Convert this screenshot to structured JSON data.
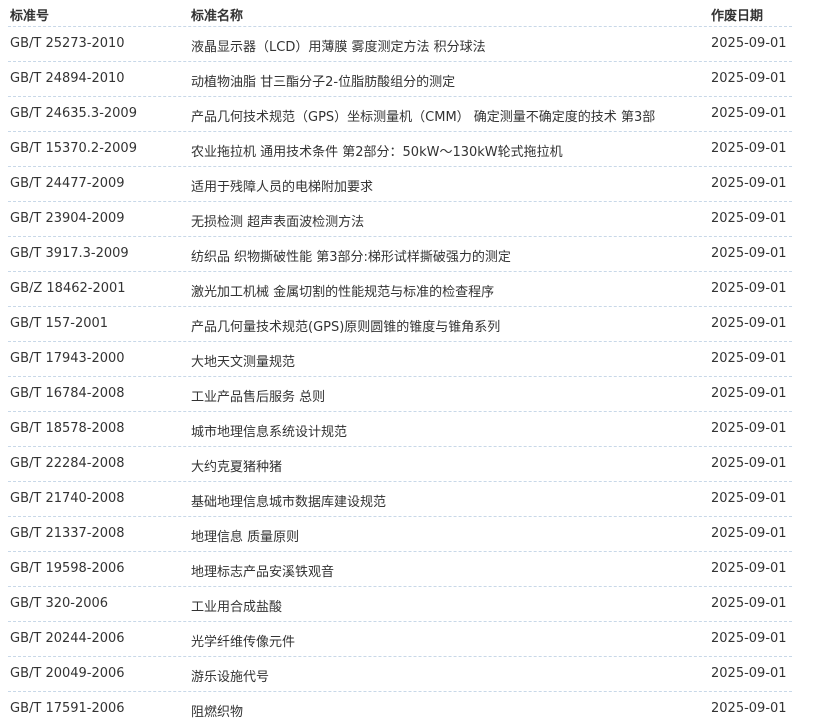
{
  "table": {
    "headers": {
      "code": "标准号",
      "name": "标准名称",
      "date": "作废日期"
    },
    "rows": [
      {
        "code": "GB/T 25273-2010",
        "name": "液晶显示器（LCD）用薄膜 雾度测定方法 积分球法",
        "date": "2025-09-01"
      },
      {
        "code": "GB/T 24894-2010",
        "name": "动植物油脂 甘三酯分子2-位脂肪酸组分的测定",
        "date": "2025-09-01"
      },
      {
        "code": "GB/T 24635.3-2009",
        "name": "产品几何技术规范（GPS）坐标测量机（CMM） 确定测量不确定度的技术 第3部",
        "date": "2025-09-01"
      },
      {
        "code": "GB/T 15370.2-2009",
        "name": "农业拖拉机 通用技术条件 第2部分：50kW～130kW轮式拖拉机",
        "date": "2025-09-01"
      },
      {
        "code": "GB/T 24477-2009",
        "name": "适用于残障人员的电梯附加要求",
        "date": "2025-09-01"
      },
      {
        "code": "GB/T 23904-2009",
        "name": "无损检测 超声表面波检测方法",
        "date": "2025-09-01"
      },
      {
        "code": "GB/T 3917.3-2009",
        "name": "纺织品 织物撕破性能 第3部分:梯形试样撕破强力的测定",
        "date": "2025-09-01"
      },
      {
        "code": "GB/Z 18462-2001",
        "name": "激光加工机械 金属切割的性能规范与标准的检查程序",
        "date": "2025-09-01"
      },
      {
        "code": "GB/T 157-2001",
        "name": "产品几何量技术规范(GPS)原则圆锥的锥度与锥角系列",
        "date": "2025-09-01"
      },
      {
        "code": "GB/T 17943-2000",
        "name": "大地天文测量规范",
        "date": "2025-09-01"
      },
      {
        "code": "GB/T 16784-2008",
        "name": "工业产品售后服务 总则",
        "date": "2025-09-01"
      },
      {
        "code": "GB/T 18578-2008",
        "name": "城市地理信息系统设计规范",
        "date": "2025-09-01"
      },
      {
        "code": "GB/T 22284-2008",
        "name": "大约克夏猪种猪",
        "date": "2025-09-01"
      },
      {
        "code": "GB/T 21740-2008",
        "name": "基础地理信息城市数据库建设规范",
        "date": "2025-09-01"
      },
      {
        "code": "GB/T 21337-2008",
        "name": "地理信息 质量原则",
        "date": "2025-09-01"
      },
      {
        "code": "GB/T 19598-2006",
        "name": "地理标志产品安溪铁观音",
        "date": "2025-09-01"
      },
      {
        "code": "GB/T 320-2006",
        "name": "工业用合成盐酸",
        "date": "2025-09-01"
      },
      {
        "code": "GB/T 20244-2006",
        "name": "光学纤维传像元件",
        "date": "2025-09-01"
      },
      {
        "code": "GB/T 20049-2006",
        "name": "游乐设施代号",
        "date": "2025-09-01"
      },
      {
        "code": "GB/T 17591-2006",
        "name": "阻燃织物",
        "date": "2025-09-01"
      }
    ]
  },
  "colors": {
    "text": "#333333",
    "separator": "#c8d8e8",
    "background": "#ffffff"
  }
}
